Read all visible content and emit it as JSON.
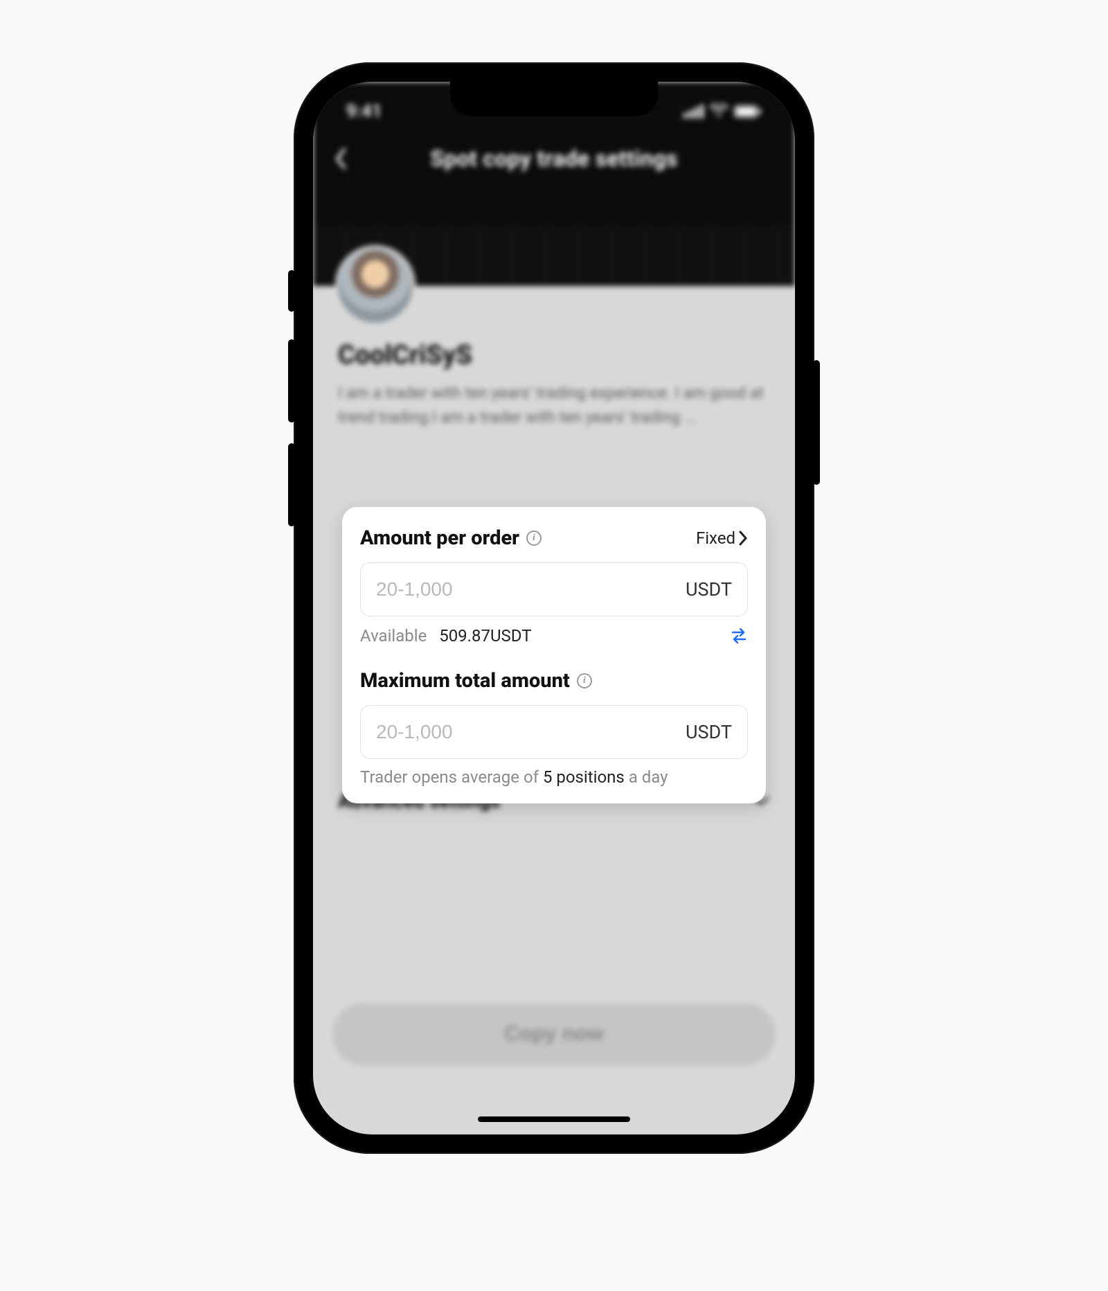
{
  "status": {
    "time": "9:41"
  },
  "header": {
    "title": "Spot copy trade settings"
  },
  "trader": {
    "name": "CoolCriSyS",
    "bio": "I am a trader with ten years' trading experience. I am good at trend trading.I am a trader with ten years' trading ..."
  },
  "amount_per_order": {
    "title": "Amount per order",
    "mode_label": "Fixed",
    "placeholder": "20-1,000",
    "unit": "USDT",
    "available_label": "Available",
    "available_value": "509.87USDT"
  },
  "max_total": {
    "title": "Maximum total amount",
    "placeholder": "20-1,000",
    "unit": "USDT",
    "hint_pre": "Trader opens average of ",
    "hint_em": "5 positions",
    "hint_post": " a day"
  },
  "advanced": {
    "title": "Advanced settings"
  },
  "cta": {
    "label": "Copy now"
  }
}
